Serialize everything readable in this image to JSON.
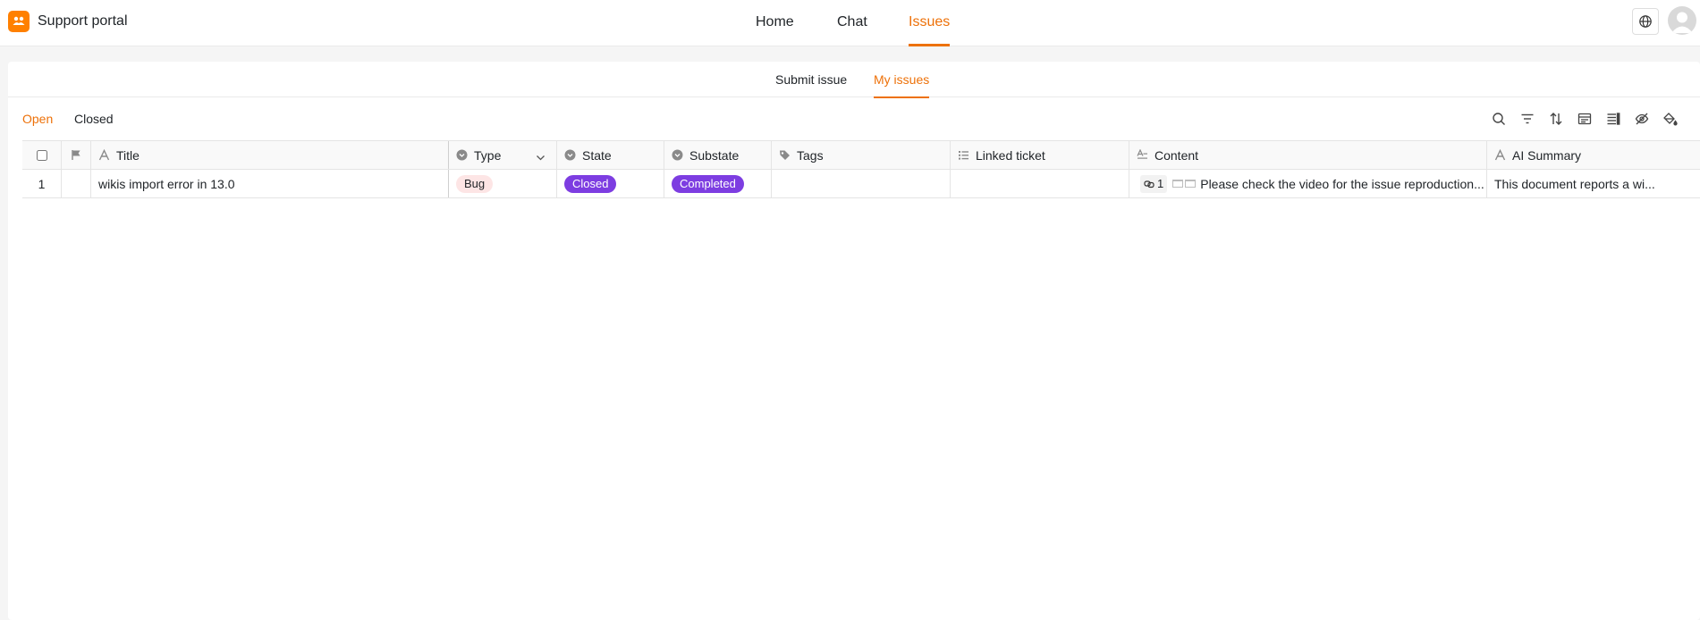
{
  "app": {
    "title": "Support portal",
    "accent_color": "#ed7109",
    "logo_color": "#ff8000"
  },
  "nav": {
    "items": [
      {
        "label": "Home",
        "active": false
      },
      {
        "label": "Chat",
        "active": false
      },
      {
        "label": "Issues",
        "active": true
      }
    ]
  },
  "header_right": {
    "language_icon": "globe-icon",
    "avatar_icon": "user-avatar-icon"
  },
  "subtabs": [
    {
      "label": "Submit issue",
      "active": false
    },
    {
      "label": "My issues",
      "active": true
    }
  ],
  "filter_tabs": [
    {
      "label": "Open",
      "active": true
    },
    {
      "label": "Closed",
      "active": false
    }
  ],
  "toolbar_icons": [
    "search-icon",
    "filter-icon",
    "sort-icon",
    "group-icon",
    "row-height-icon",
    "hide-columns-icon",
    "paint-bucket-icon"
  ],
  "table": {
    "columns": [
      {
        "key": "title",
        "label": "Title",
        "icon": "text-icon"
      },
      {
        "key": "type",
        "label": "Type",
        "icon": "single-select-icon"
      },
      {
        "key": "state",
        "label": "State",
        "icon": "single-select-icon"
      },
      {
        "key": "substate",
        "label": "Substate",
        "icon": "single-select-icon"
      },
      {
        "key": "tags",
        "label": "Tags",
        "icon": "tag-icon"
      },
      {
        "key": "linked_ticket",
        "label": "Linked ticket",
        "icon": "link-list-icon"
      },
      {
        "key": "content",
        "label": "Content",
        "icon": "long-text-icon"
      },
      {
        "key": "ai_summary",
        "label": "AI Summary",
        "icon": "text-icon"
      }
    ],
    "rows": [
      {
        "index": "1",
        "title": "wikis import error in 13.0",
        "type": "Bug",
        "state": "Closed",
        "substate": "Completed",
        "tags": "",
        "linked_ticket": "",
        "content_link_count": "1",
        "content": "Please check the video for the issue reproduction...",
        "ai_summary": "This document reports a wi..."
      }
    ]
  },
  "colors": {
    "state_badge": "#7d3de1",
    "bug_badge": "#fde5e5"
  }
}
